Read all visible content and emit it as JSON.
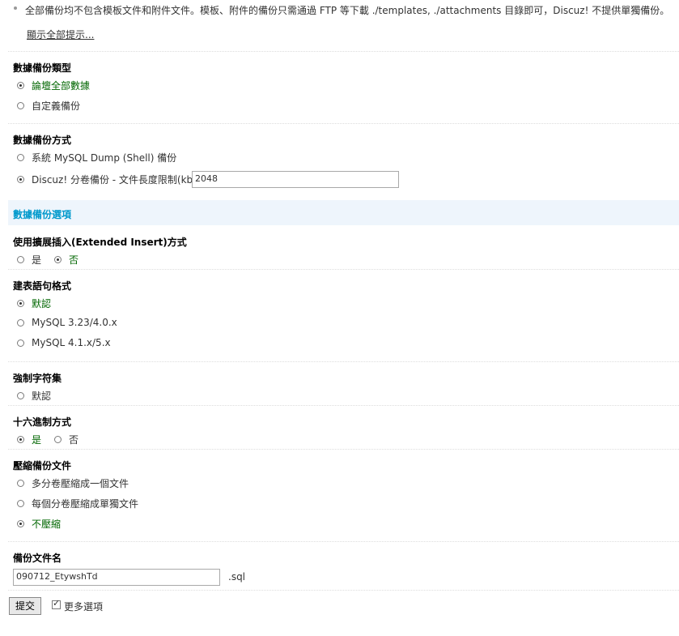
{
  "tips": {
    "line": "全部備份均不包含模板文件和附件文件。模板、附件的備份只需通過 FTP 等下載 ./templates, ./attachments 目錄即可，Discuz! 不提供單獨備份。",
    "show_all": "顯示全部提示..."
  },
  "backup_type": {
    "title": "數據備份類型",
    "options": [
      "論壇全部數據",
      "自定義備份"
    ],
    "selected": 0
  },
  "backup_method": {
    "title": "數據備份方式",
    "options": [
      "系統 MySQL Dump (Shell) 備份",
      "Discuz! 分卷備份 - 文件長度限制(kb)"
    ],
    "selected": 1,
    "size_limit": "2048"
  },
  "section_title": "數據備份選項",
  "extended_insert": {
    "title": "使用擴展插入(Extended Insert)方式",
    "options": [
      "是",
      "否"
    ],
    "selected": 1
  },
  "sql_format": {
    "title": "建表語句格式",
    "options": [
      "默認",
      "MySQL 3.23/4.0.x",
      "MySQL 4.1.x/5.x"
    ],
    "selected": 0
  },
  "charset": {
    "title": "強制字符集",
    "options": [
      "默認"
    ],
    "selected": -1
  },
  "hex": {
    "title": "十六進制方式",
    "options": [
      "是",
      "否"
    ],
    "selected": 0
  },
  "compress": {
    "title": "壓縮備份文件",
    "options": [
      "多分卷壓縮成一個文件",
      "每個分卷壓縮成單獨文件",
      "不壓縮"
    ],
    "selected": 2
  },
  "filename": {
    "title": "備份文件名",
    "value": "090712_EtywshTd",
    "ext": ".sql"
  },
  "submit_label": "提交",
  "more_options_label": "更多選項"
}
